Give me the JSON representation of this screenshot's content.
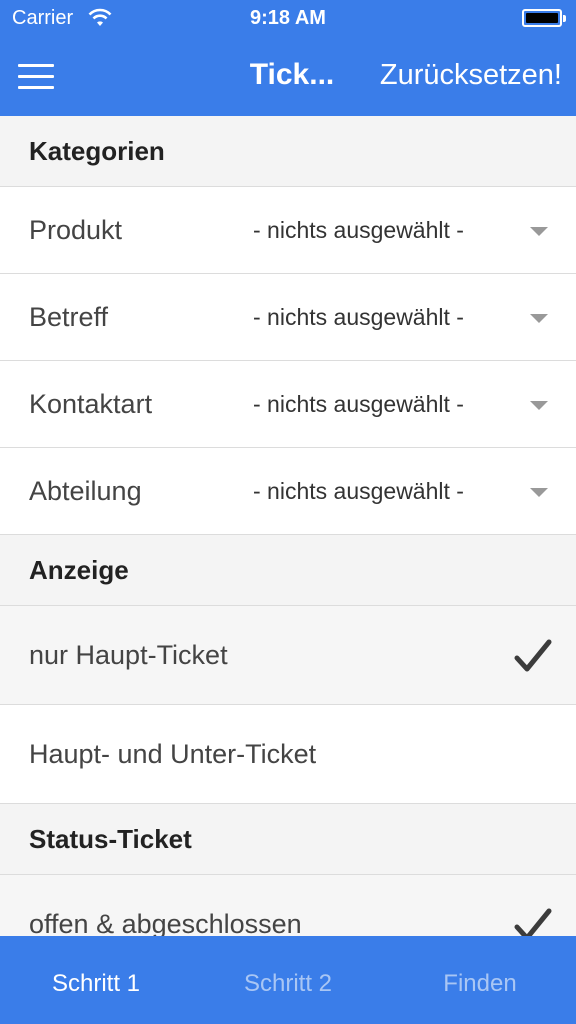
{
  "status_bar": {
    "carrier": "Carrier",
    "time": "9:18 AM"
  },
  "nav": {
    "title": "Tick...",
    "reset_label": "Zurücksetzen!",
    "menu_icon": "hamburger-menu-icon"
  },
  "sections": {
    "kategorien": {
      "title": "Kategorien",
      "rows": [
        {
          "label": "Produkt",
          "value": "- nichts ausgewählt -"
        },
        {
          "label": "Betreff",
          "value": "- nichts ausgewählt -"
        },
        {
          "label": "Kontaktart",
          "value": "- nichts ausgewählt -"
        },
        {
          "label": "Abteilung",
          "value": "- nichts ausgewählt -"
        }
      ]
    },
    "anzeige": {
      "title": "Anzeige",
      "options": [
        {
          "label": "nur Haupt-Ticket",
          "checked": true
        },
        {
          "label": "Haupt- und Unter-Ticket",
          "checked": false
        }
      ]
    },
    "status": {
      "title": "Status-Ticket",
      "options": [
        {
          "label": "offen & abgeschlossen",
          "checked": true
        }
      ]
    }
  },
  "tabbar": {
    "tabs": [
      {
        "label": "Schritt 1",
        "active": true
      },
      {
        "label": "Schritt 2",
        "active": false
      },
      {
        "label": "Finden",
        "active": false
      }
    ]
  },
  "colors": {
    "accent": "#3a7de9",
    "section_bg": "#f4f4f4",
    "inactive_tab": "#a9c6f4"
  }
}
